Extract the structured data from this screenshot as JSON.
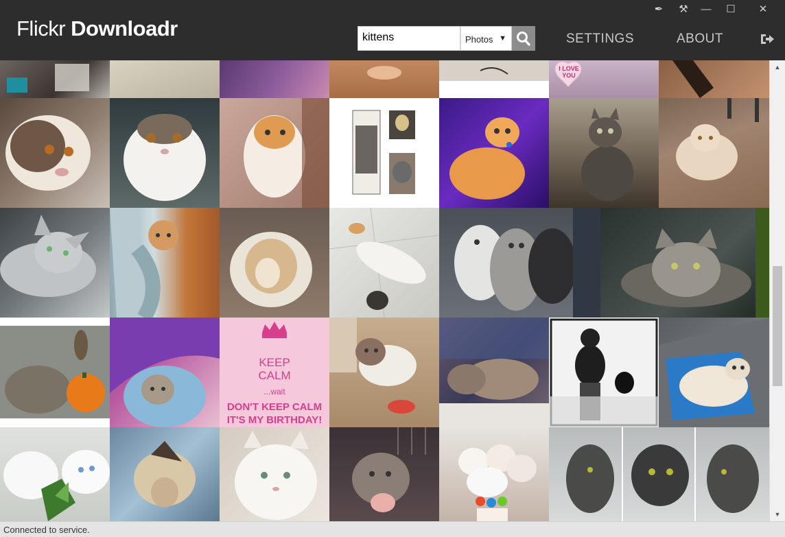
{
  "app": {
    "title_light": "Flickr",
    "title_bold": "Downloadr"
  },
  "window_controls": [
    {
      "name": "pin-icon",
      "glyph": "✒"
    },
    {
      "name": "tools-icon",
      "glyph": "⚒"
    },
    {
      "name": "minimize-icon",
      "glyph": "—"
    },
    {
      "name": "maximize-icon",
      "glyph": "☐"
    },
    {
      "name": "close-icon",
      "glyph": "✕"
    }
  ],
  "search": {
    "value": "kittens",
    "type_selected": "Photos",
    "type_caret": "▼"
  },
  "nav": {
    "settings": "SETTINGS",
    "about": "ABOUT"
  },
  "keep_calm": {
    "line1": "KEEP",
    "line2": "CALM",
    "line3": "...wait",
    "line4": "DON'T KEEP CALM",
    "line5": "IT'S MY BIRTHDAY!"
  },
  "love_heart": {
    "line1": "I LOVE",
    "line2": "YOU"
  },
  "scrollbar": {
    "up": "▲",
    "down": "▼"
  },
  "status": {
    "text": "Connected to service."
  },
  "colors": {
    "header_bg": "#2d2d2d",
    "accent_pink": "#d63f8c",
    "status_bg": "#e4e4e4"
  }
}
